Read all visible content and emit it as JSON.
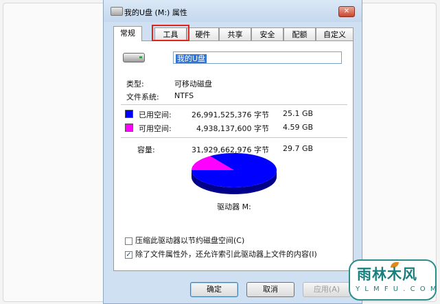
{
  "window": {
    "title": "我的U盘 (M:) 属性",
    "close_glyph": "✕"
  },
  "tabs": [
    {
      "label": "常规",
      "active": true
    },
    {
      "label": "工具",
      "highlighted": true
    },
    {
      "label": "硬件"
    },
    {
      "label": "共享"
    },
    {
      "label": "安全"
    },
    {
      "label": "配额"
    },
    {
      "label": "自定义"
    }
  ],
  "general": {
    "drive_name": "我的U盘",
    "type_label": "类型:",
    "type_value": "可移动磁盘",
    "fs_label": "文件系统:",
    "fs_value": "NTFS"
  },
  "space": {
    "used": {
      "label": "已用空间:",
      "bytes": "26,991,525,376 字节",
      "gb": "25.1 GB",
      "color": "#0000ff"
    },
    "free": {
      "label": "可用空间:",
      "bytes": "4,938,137,600 字节",
      "gb": "4.59 GB",
      "color": "#ff00ff"
    },
    "capacity": {
      "label": "容量:",
      "bytes": "31,929,662,976 字节",
      "gb": "29.7 GB"
    },
    "used_fraction": 0.845
  },
  "drive_label": "驱动器 M:",
  "options": [
    {
      "label": "压缩此驱动器以节约磁盘空间(C)",
      "checked": false
    },
    {
      "label": "除了文件属性外，还允许索引此驱动器上文件的内容(I)",
      "checked": true
    }
  ],
  "buttons": {
    "ok": "确定",
    "cancel": "取消",
    "apply": "应用(A)"
  },
  "watermark": {
    "title": "雨林木风",
    "sub": "Y L M F U . C O M"
  }
}
